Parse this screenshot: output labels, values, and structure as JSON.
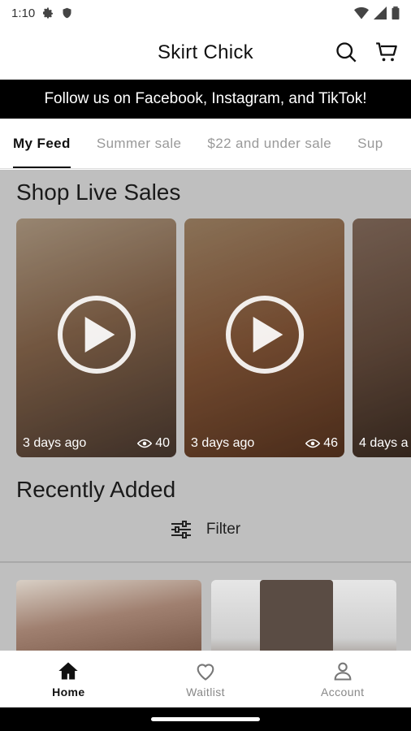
{
  "status_bar": {
    "time": "1:10"
  },
  "header": {
    "title": "Skirt Chick"
  },
  "banner": {
    "text": "Follow us on Facebook, Instagram, and TikTok!"
  },
  "tabs": [
    {
      "label": "My Feed",
      "active": true
    },
    {
      "label": "Summer sale",
      "active": false
    },
    {
      "label": "$22 and under sale",
      "active": false
    },
    {
      "label": "Sup",
      "active": false
    }
  ],
  "live_sales": {
    "title": "Shop Live Sales",
    "videos": [
      {
        "age": "3 days ago",
        "views": "40"
      },
      {
        "age": "3 days ago",
        "views": "46"
      },
      {
        "age": "4 days a",
        "views": ""
      }
    ]
  },
  "recent": {
    "title": "Recently Added",
    "filter_label": "Filter"
  },
  "bottom_nav": [
    {
      "label": "Home",
      "icon": "home-icon",
      "active": true
    },
    {
      "label": "Waitlist",
      "icon": "heart-icon",
      "active": false
    },
    {
      "label": "Account",
      "icon": "account-icon",
      "active": false
    }
  ],
  "colors": {
    "banner_bg": "#000000",
    "accent": "#111111",
    "inactive": "#999999"
  }
}
